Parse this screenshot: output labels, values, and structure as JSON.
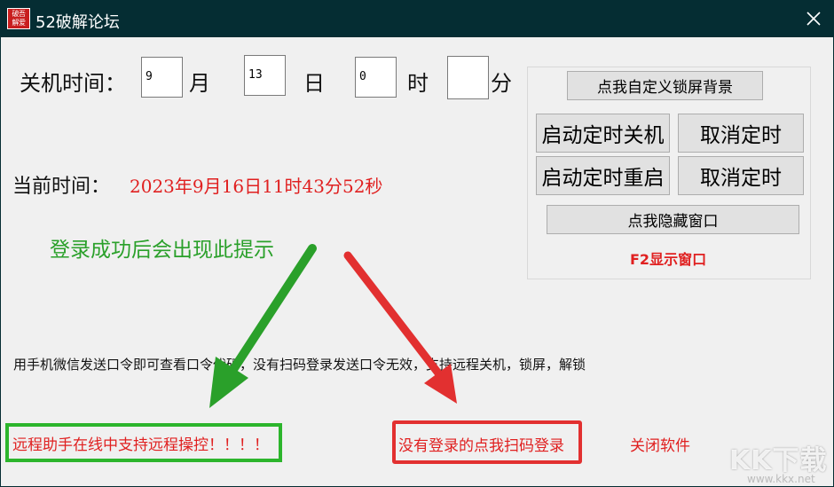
{
  "window": {
    "title": "52破解论坛",
    "icon_chars": [
      "破",
      "吾",
      "解",
      "爱"
    ]
  },
  "schedule": {
    "label": "关机时间：",
    "month_value": "9",
    "month_unit": "月",
    "day_value": "13",
    "day_unit": "日",
    "hour_value": "0",
    "hour_unit": "时",
    "minute_value": "",
    "minute_unit": "分"
  },
  "current_time": {
    "label": "当前时间：",
    "value": "2023年9月16日11时43分52秒"
  },
  "controls": {
    "custom_lock_bg": "点我自定义锁屏背景",
    "start_shutdown": "启动定时关机",
    "cancel_timer_1": "取消定时",
    "start_restart": "启动定时重启",
    "cancel_timer_2": "取消定时",
    "hide_window": "点我隐藏窗口",
    "f2_hint": "F2显示窗口"
  },
  "annotation": {
    "login_success": "登录成功后会出现此提示"
  },
  "info_line": "用手机微信发送口令即可查看口令代码，没有扫码登录发送口令无效，支持远程关机，锁屏，解锁",
  "footer": {
    "remote_status": "远程助手在线中支持远程操控！！！！",
    "scan_login": "没有登录的点我扫码登录",
    "close_software": "关闭软件"
  },
  "watermark": {
    "logo": "KK下载",
    "url": "www.kkx.net"
  },
  "colors": {
    "titlebar": "#052d33",
    "red_text": "#e02020",
    "green_arrow": "#2aa02a",
    "red_arrow": "#e23030"
  }
}
